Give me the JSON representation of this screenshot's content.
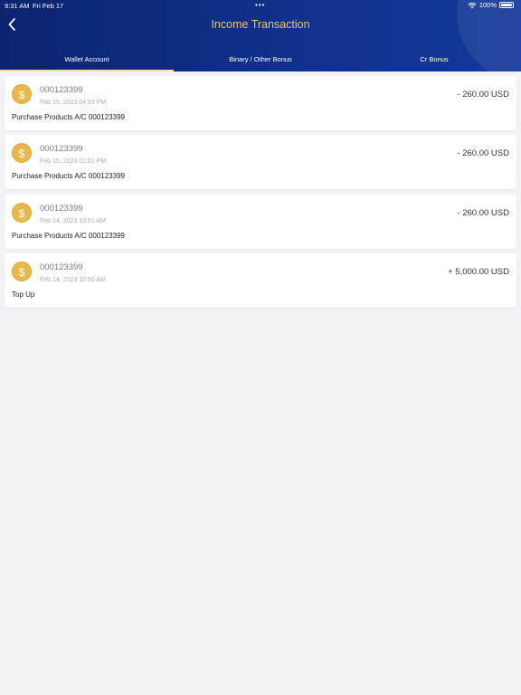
{
  "status_bar": {
    "time": "9:31 AM",
    "date": "Fri Feb 17",
    "dots": "•••",
    "battery_text": "100%"
  },
  "header": {
    "title": "Income Transaction",
    "back_icon": "chevron-left-icon"
  },
  "tabs": [
    {
      "label": "Wallet Account",
      "active": true
    },
    {
      "label": "Binary / Other Bonus",
      "active": false
    },
    {
      "label": "Cr Bonus",
      "active": false
    }
  ],
  "transactions": [
    {
      "account": "000123399",
      "datetime": "Feb 15, 2023 04:53 PM",
      "description": "Purchase Products A/C 000123399",
      "amount": "- 260.00 USD",
      "icon": "$"
    },
    {
      "account": "000123399",
      "datetime": "Feb 15, 2023 01:01 PM",
      "description": "Purchase Products A/C 000123399",
      "amount": "- 260.00 USD",
      "icon": "$"
    },
    {
      "account": "000123399",
      "datetime": "Feb 14, 2023 10:51 AM",
      "description": "Purchase Products A/C 000123399",
      "amount": "- 260.00 USD",
      "icon": "$"
    },
    {
      "account": "000123399",
      "datetime": "Feb 14, 2023 10:50 AM",
      "description": "Top Up",
      "amount": "+ 5,000.00 USD",
      "icon": "$"
    }
  ],
  "colors": {
    "header_start": "#0b2470",
    "header_end": "#14399b",
    "title": "#e8c66a",
    "coin": "#e9b84c",
    "background": "#f2f3f7"
  }
}
